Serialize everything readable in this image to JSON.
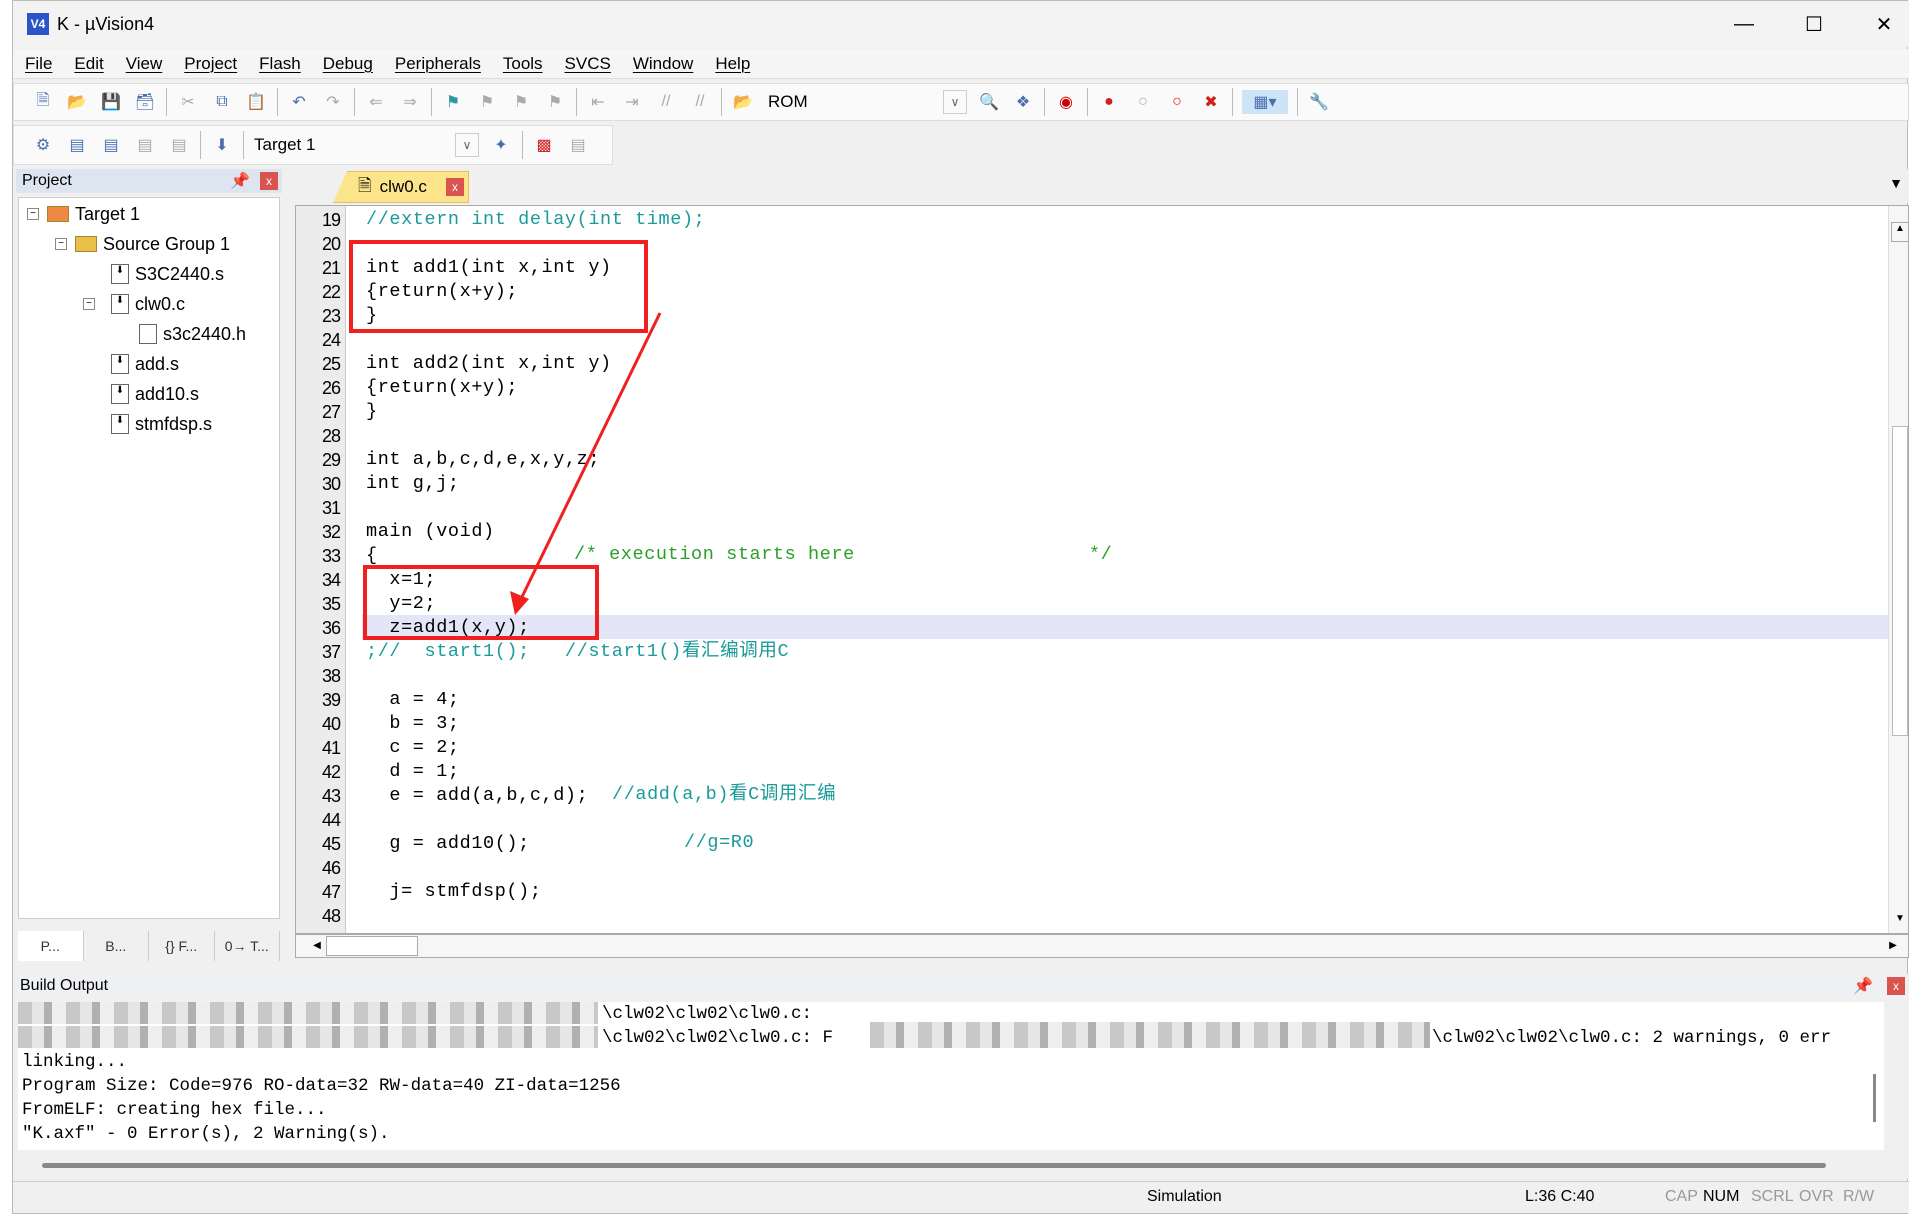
{
  "window": {
    "title": "K  - µVision4",
    "logo": "V4"
  },
  "menu": [
    "File",
    "Edit",
    "View",
    "Project",
    "Flash",
    "Debug",
    "Peripherals",
    "Tools",
    "SVCS",
    "Window",
    "Help"
  ],
  "toolbar1": {
    "rom_label": "ROM"
  },
  "toolbar2": {
    "target": "Target 1"
  },
  "project": {
    "title": "Project",
    "tree": [
      {
        "label": "Target 1"
      },
      {
        "label": "Source Group 1"
      },
      {
        "label": "S3C2440.s"
      },
      {
        "label": "clw0.c"
      },
      {
        "label": "s3c2440.h"
      },
      {
        "label": "add.s"
      },
      {
        "label": "add10.s"
      },
      {
        "label": "stmfdsp.s"
      }
    ],
    "tabs": [
      "P...",
      "B...",
      "{} F...",
      "0→ T..."
    ]
  },
  "editor": {
    "tab": "clw0.c",
    "line_numbers": [
      "19",
      "20",
      "21",
      "22",
      "23",
      "24",
      "25",
      "26",
      "27",
      "28",
      "29",
      "30",
      "31",
      "32",
      "33",
      "34",
      "35",
      "36",
      "37",
      "38",
      "39",
      "40",
      "41",
      "42",
      "43",
      "44",
      "45",
      "46",
      "47",
      "48"
    ],
    "lines": [
      {
        "c": "//extern int delay(int time);",
        "cls": "cm"
      },
      {
        "c": "",
        "cls": "kw"
      },
      {
        "c": "int add1(int x,int y)",
        "cls": "kw"
      },
      {
        "c": "{return(x+y);",
        "cls": "kw"
      },
      {
        "c": "}",
        "cls": "kw"
      },
      {
        "c": "",
        "cls": "kw"
      },
      {
        "c": "int add2(int x,int y)",
        "cls": "kw"
      },
      {
        "c": "{return(x+y);",
        "cls": "kw"
      },
      {
        "c": "}",
        "cls": "kw"
      },
      {
        "c": "",
        "cls": "kw"
      },
      {
        "c": "int a,b,c,d,e,x,y,z;",
        "cls": "kw"
      },
      {
        "c": "int g,j;",
        "cls": "kw"
      },
      {
        "c": "",
        "cls": "kw"
      },
      {
        "c": "main (void)",
        "cls": "kw"
      },
      {
        "c": "{",
        "cls": "kw"
      },
      {
        "c": "  x=1;",
        "cls": "kw"
      },
      {
        "c": "  y=2;",
        "cls": "kw"
      },
      {
        "c": "  z=add1(x,y);",
        "cls": "kw"
      },
      {
        "c": ";//  start1();   //start1()看汇编调用C",
        "cls": "cm"
      },
      {
        "c": "",
        "cls": "kw"
      },
      {
        "c": "  a = 4;",
        "cls": "kw"
      },
      {
        "c": "  b = 3;",
        "cls": "kw"
      },
      {
        "c": "  c = 2;",
        "cls": "kw"
      },
      {
        "c": "  d = 1;",
        "cls": "kw"
      },
      {
        "c": "  e = add(a,b,c,d); ",
        "cls": "kw"
      },
      {
        "c": "",
        "cls": "kw"
      },
      {
        "c": "  g = add10();",
        "cls": "kw"
      },
      {
        "c": "",
        "cls": "kw"
      },
      {
        "c": "  j= stmfdsp();",
        "cls": "kw"
      },
      {
        "c": "",
        "cls": "kw"
      }
    ],
    "comment_33": "/* execution starts here                    */",
    "comment_43": "//add(a,b)看C调用汇编",
    "comment_45": "//g=R0",
    "current_line": "36"
  },
  "build": {
    "title": "Build Output",
    "lines": [
      "\\clw02\\clw02\\clw0.c:",
      "\\clw02\\clw02\\clw0.c: F",
      "\\clw02\\clw02\\clw0.c: 2 warnings, 0 err",
      "linking...",
      "Program Size: Code=976 RO-data=32 RW-data=40 ZI-data=1256",
      "FromELF: creating hex file...",
      "\"K.axf\" - 0 Error(s), 2 Warning(s)."
    ]
  },
  "status": {
    "mode": "Simulation",
    "position": "L:36 C:40",
    "cap": "CAP",
    "num": "NUM",
    "scrl": "SCRL",
    "ovr": "OVR",
    "rw": "R/W"
  },
  "colors": {
    "annotation": "#f02020",
    "comment": "#1a9a9a",
    "highlight": "#e4e6f7",
    "tab": "#fce48a"
  }
}
